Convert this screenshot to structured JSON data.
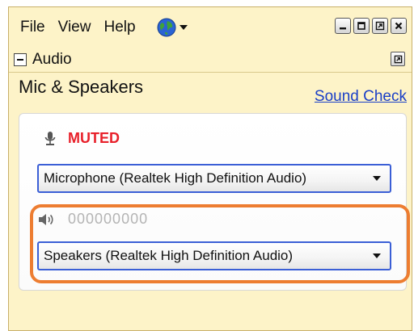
{
  "menu": {
    "file": "File",
    "view": "View",
    "help": "Help"
  },
  "icons": {
    "globe": "globe-icon",
    "dropdown_arrow": "chevron-down-icon",
    "mic": "microphone-icon",
    "speaker": "speaker-icon"
  },
  "panel": {
    "title": "Audio"
  },
  "section": {
    "title": "Mic & Speakers",
    "sound_check": "Sound Check"
  },
  "microphone": {
    "status": "MUTED",
    "device": "Microphone (Realtek High Definition Audio)"
  },
  "speakers": {
    "level_display": "000000000",
    "device": "Speakers (Realtek High Definition Audio)"
  },
  "colors": {
    "window_bg": "#fdf3c8",
    "muted_red": "#e8202a",
    "link_blue": "#1a3fc7",
    "dropdown_border": "#3b5fd6",
    "highlight_orange": "#ed7d31"
  }
}
